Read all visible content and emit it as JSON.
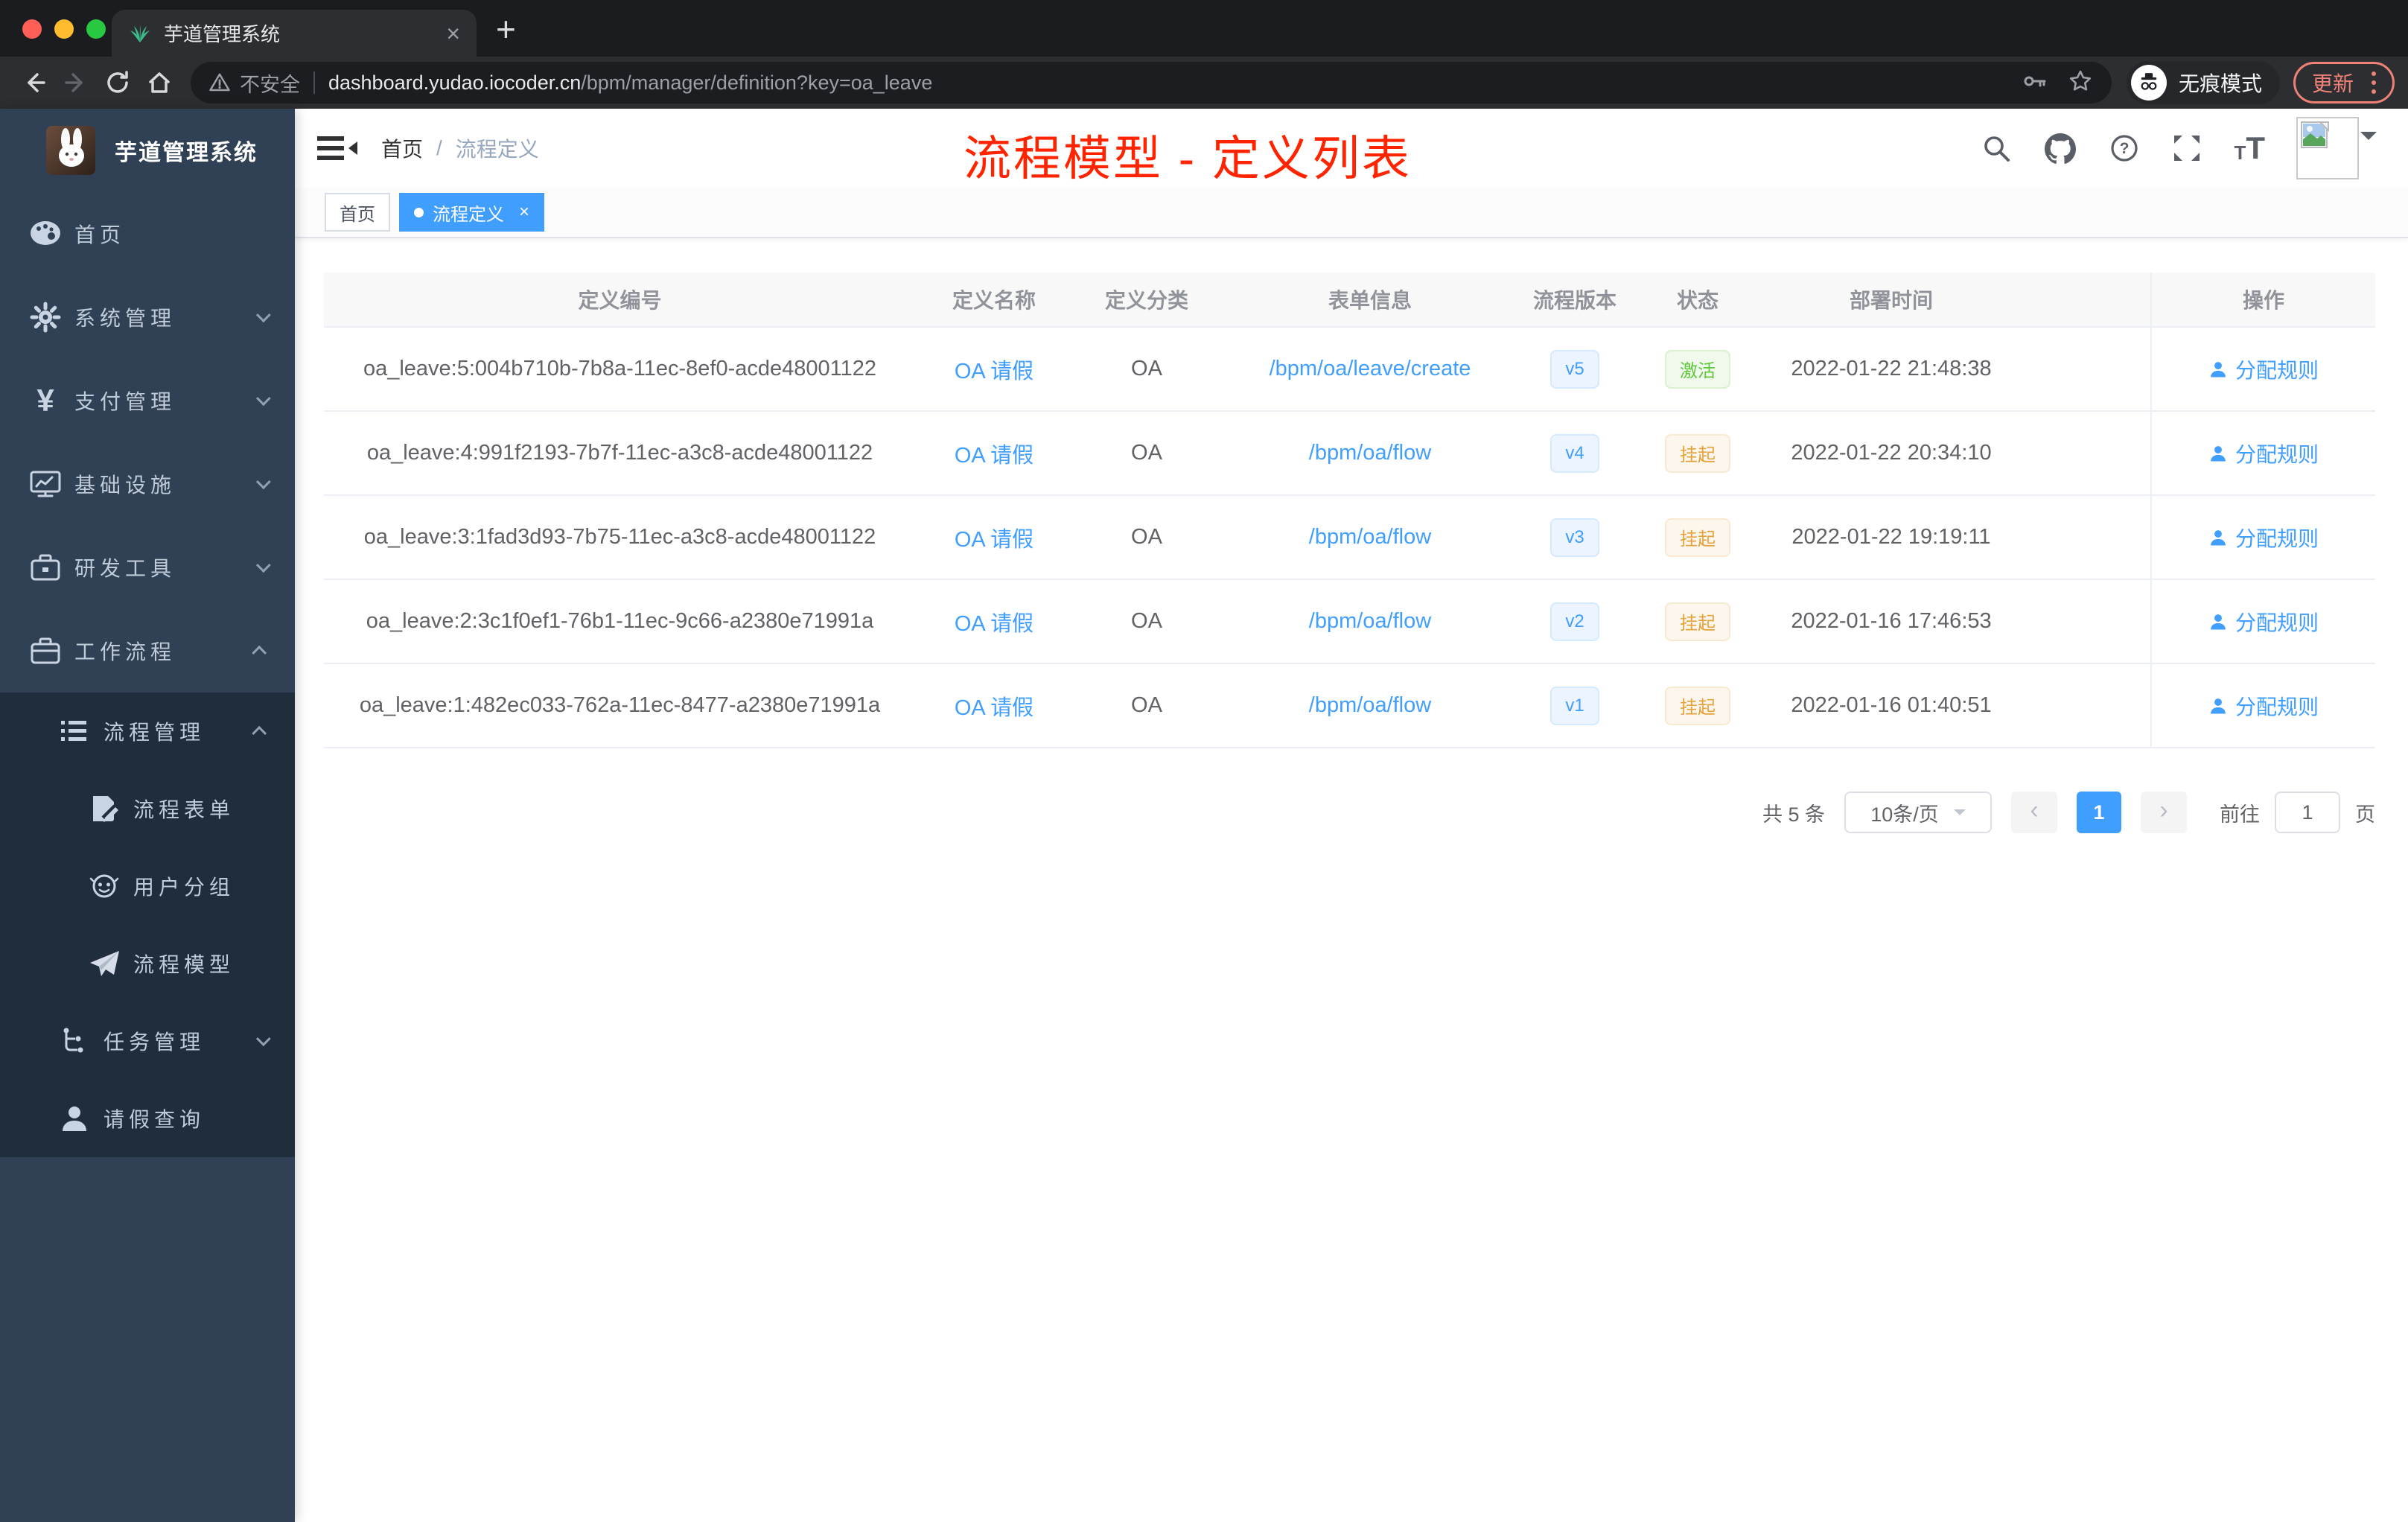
{
  "colors": {
    "accent": "#409eff",
    "sidebar_bg": "#304156",
    "submenu_bg": "#1f2d3d",
    "annotation_red": "#ff2400",
    "success": "#5ec73a",
    "warning": "#e6a23c"
  },
  "browser": {
    "tab_title": "芋道管理系统",
    "tab_close": "×",
    "new_tab": "+",
    "insecure_label": "不安全",
    "url_host": "dashboard.yudao.iocoder.cn",
    "url_path": "/bpm/manager/definition?key=oa_leave",
    "incognito_label": "无痕模式",
    "update_label": "更新"
  },
  "app": {
    "logo_title": "芋道管理系统",
    "breadcrumb": {
      "home": "首页",
      "separator": "/",
      "current": "流程定义"
    },
    "annotation": "流程模型 - 定义列表",
    "header": {
      "help_glyph": "?",
      "size_glyph": "T"
    }
  },
  "tags": [
    {
      "label": "首页",
      "active": false
    },
    {
      "label": "流程定义",
      "active": true,
      "close": "×"
    }
  ],
  "sidebar": {
    "items": [
      {
        "label": "首页",
        "icon": "dashboard-icon"
      },
      {
        "label": "系统管理",
        "icon": "gear-icon"
      },
      {
        "label": "支付管理",
        "icon": "yuan-icon",
        "yuan_glyph": "¥"
      },
      {
        "label": "基础设施",
        "icon": "monitor-icon"
      },
      {
        "label": "研发工具",
        "icon": "toolbox-icon"
      },
      {
        "label": "工作流程",
        "icon": "briefcase-icon",
        "children": [
          {
            "label": "流程管理",
            "icon": "list-icon",
            "children": [
              {
                "label": "流程表单",
                "icon": "form-icon"
              },
              {
                "label": "用户分组",
                "icon": "robot-icon"
              },
              {
                "label": "流程模型",
                "icon": "paper-plane-icon"
              }
            ]
          },
          {
            "label": "任务管理",
            "icon": "tree-icon"
          },
          {
            "label": "请假查询",
            "icon": "user-icon"
          }
        ]
      }
    ]
  },
  "table": {
    "columns": [
      "定义编号",
      "定义名称",
      "定义分类",
      "表单信息",
      "流程版本",
      "状态",
      "部署时间",
      "操作"
    ],
    "rows": [
      {
        "id": "oa_leave:5:004b710b-7b8a-11ec-8ef0-acde48001122",
        "name": "OA 请假",
        "category": "OA",
        "form": "/bpm/oa/leave/create",
        "version": "v5",
        "status": "激活",
        "status_class": "badge success",
        "time": "2022-01-22 21:48:38",
        "action": "分配规则"
      },
      {
        "id": "oa_leave:4:991f2193-7b7f-11ec-a3c8-acde48001122",
        "name": "OA 请假",
        "category": "OA",
        "form": "/bpm/oa/flow",
        "version": "v4",
        "status": "挂起",
        "status_class": "badge warning",
        "time": "2022-01-22 20:34:10",
        "action": "分配规则"
      },
      {
        "id": "oa_leave:3:1fad3d93-7b75-11ec-a3c8-acde48001122",
        "name": "OA 请假",
        "category": "OA",
        "form": "/bpm/oa/flow",
        "version": "v3",
        "status": "挂起",
        "status_class": "badge warning",
        "time": "2022-01-22 19:19:11",
        "action": "分配规则"
      },
      {
        "id": "oa_leave:2:3c1f0ef1-76b1-11ec-9c66-a2380e71991a",
        "name": "OA 请假",
        "category": "OA",
        "form": "/bpm/oa/flow",
        "version": "v2",
        "status": "挂起",
        "status_class": "badge warning",
        "time": "2022-01-16 17:46:53",
        "action": "分配规则"
      },
      {
        "id": "oa_leave:1:482ec033-762a-11ec-8477-a2380e71991a",
        "name": "OA 请假",
        "category": "OA",
        "form": "/bpm/oa/flow",
        "version": "v1",
        "status": "挂起",
        "status_class": "badge warning",
        "time": "2022-01-16 01:40:51",
        "action": "分配规则"
      }
    ]
  },
  "pagination": {
    "total": "共 5 条",
    "page_size": "10条/页",
    "prev": "‹",
    "page": "1",
    "next": "›",
    "goto_label": "前往",
    "goto_value": "1",
    "goto_unit": "页"
  }
}
